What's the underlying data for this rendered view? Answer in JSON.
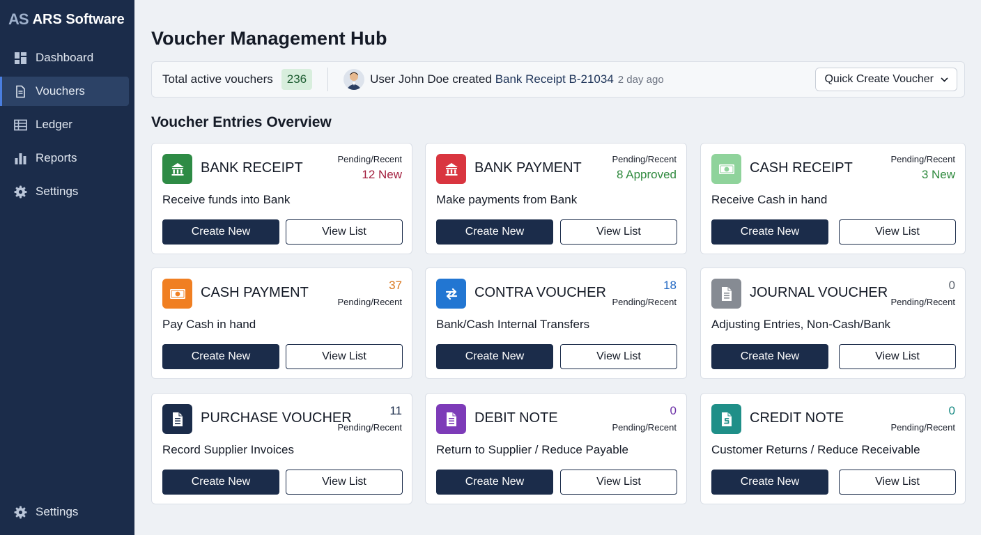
{
  "brand": {
    "logo": "AS",
    "name": "ARS Software"
  },
  "sidebar": {
    "items": [
      {
        "label": "Dashboard",
        "icon": "dashboard-icon"
      },
      {
        "label": "Vouchers",
        "icon": "document-icon",
        "active": true
      },
      {
        "label": "Ledger",
        "icon": "table-icon"
      },
      {
        "label": "Reports",
        "icon": "bar-chart-icon"
      },
      {
        "label": "Settings",
        "icon": "gear-icon"
      }
    ],
    "bottom_item": {
      "label": "Settings",
      "icon": "gear-icon"
    }
  },
  "page": {
    "title": "Voucher Management Hub"
  },
  "activity": {
    "total_label": "Total active vouchers",
    "total_count": "236",
    "text_prefix": "User John Doe created",
    "link_text": "Bank Receipt B-21034",
    "time": "2 day ago",
    "quick_create_label": "Quick Create Voucher"
  },
  "overview": {
    "title": "Voucher Entries Overview",
    "create_label": "Create New",
    "view_label": "View List",
    "cards": [
      {
        "title": "BANK RECEIPT",
        "desc": "Receive funds into Bank",
        "status_label": "Pending/Recent",
        "status_value": "12 New",
        "status_color": "#a3203f",
        "icon_color": "#2e8b45",
        "icon": "bank-icon"
      },
      {
        "title": "BANK PAYMENT",
        "desc": "Make payments from Bank",
        "status_label": "Pending/Recent",
        "status_value": "8 Approved",
        "status_color": "#2f8a3e",
        "icon_color": "#d9353f",
        "icon": "bank-icon"
      },
      {
        "title": "CASH RECEIPT",
        "desc": "Receive Cash in hand",
        "status_label": "Pending/Recent",
        "status_value": "3 New",
        "status_color": "#2f8a3e",
        "icon_color": "#8fd39b",
        "icon": "cash-icon"
      },
      {
        "title": "CASH PAYMENT",
        "desc": "Pay Cash in hand",
        "status_label": "Pending/Recent",
        "status_value": "37",
        "status_color": "#d9761c",
        "icon_color": "#f07f22",
        "icon": "cash-icon"
      },
      {
        "title": "CONTRA VOUCHER",
        "desc": "Bank/Cash Internal Transfers",
        "status_label": "Pending/Recent",
        "status_value": "18",
        "status_color": "#1f66c2",
        "icon_color": "#2276d2",
        "icon": "transfer-icon"
      },
      {
        "title": "JOURNAL VOUCHER",
        "desc": "Adjusting Entries, Non-Cash/Bank",
        "status_label": "Pending/Recent",
        "status_value": "0",
        "status_color": "#5f6670",
        "icon_color": "#868b93",
        "icon": "document-icon"
      },
      {
        "title": "PURCHASE VOUCHER",
        "desc": "Record Supplier Invoices",
        "status_label": "Pending/Recent",
        "status_value": "11",
        "status_color": "#1b2c4a",
        "icon_color": "#1b2c4a",
        "icon": "document-icon"
      },
      {
        "title": "DEBIT NOTE",
        "desc": "Return to Supplier / Reduce Payable",
        "status_label": "Pending/Recent",
        "status_value": "0",
        "status_color": "#6b2fa6",
        "icon_color": "#7d3bb8",
        "icon": "document-icon"
      },
      {
        "title": "CREDIT NOTE",
        "desc": "Customer Returns / Reduce Receivable",
        "status_label": "Pending/Recent",
        "status_value": "0",
        "status_color": "#1a8a84",
        "icon_color": "#1f8f88",
        "icon": "refund-document-icon"
      }
    ]
  }
}
